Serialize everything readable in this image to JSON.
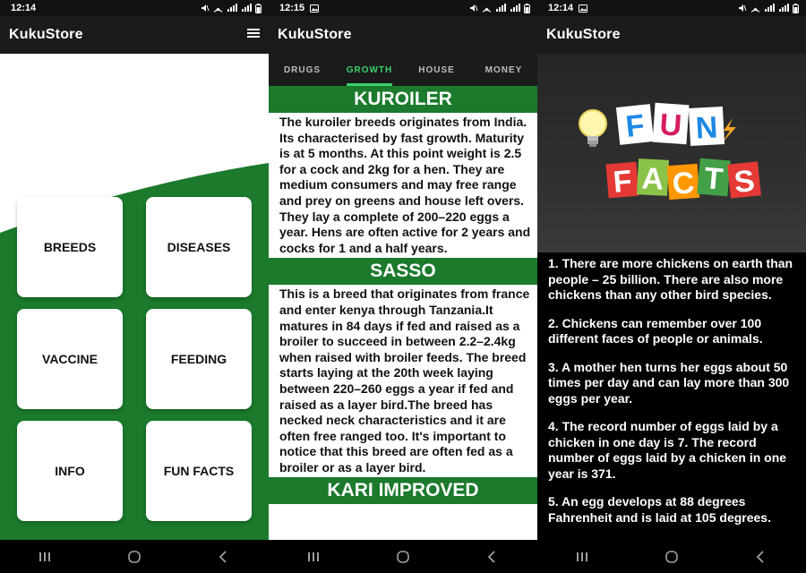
{
  "screens": [
    {
      "status_time": "12:14",
      "app_title": "KukuStore",
      "menu_icon": "hamburger-menu-icon",
      "tiles": [
        "BREEDS",
        "DISEASES",
        "VACCINE",
        "FEEDING",
        "INFO",
        "FUN FACTS"
      ],
      "colors": {
        "green": "#1b7a2c",
        "bar": "#1b1b1b"
      }
    },
    {
      "status_time": "12:15",
      "app_title": "KukuStore",
      "tabs": [
        "DRUGS",
        "GROWTH",
        "HOUSE",
        "MONEY"
      ],
      "active_tab": "GROWTH",
      "breeds": [
        {
          "title": "KUROILER",
          "text": "The kuroiler breeds originates from India. Its characterised by fast growth. Maturity is at 5 months. At this point weight is 2.5 for a cock and 2kg for a hen. They are medium consumers and may free range and prey on greens and house left overs. They lay a complete of 200–220 eggs a year. Hens are often active for 2 years and cocks for 1 and a half years."
        },
        {
          "title": "SASSO",
          "text": "This is a breed that originates from france and enter kenya through Tanzania.It matures in 84 days if fed and raised as a broiler to succeed in between 2.2–2.4kg when raised with broiler feeds. The breed starts laying at the 20th week laying between 220–260 eggs a year if fed and raised as a layer bird.The breed has necked neck characteristics and it are often free ranged too. It's important to notice that this breed are often fed as a broiler or as a layer bird."
        },
        {
          "title": "KARI IMPROVED",
          "text": ""
        }
      ],
      "colors": {
        "active_tab": "#3ad16a"
      }
    },
    {
      "status_time": "12:14",
      "app_title": "KukuStore",
      "banner_logo": {
        "line1": "FUN",
        "line2": "FACTS"
      },
      "facts": [
        "1. There are more chickens on earth than people – 25 billion. There are also more chickens than any other bird species.",
        "2. Chickens can remember over 100 different faces of people or animals.",
        "3. A mother hen turns her eggs about 50 times per day and can lay more than 300 eggs per year.",
        "4. The record number of eggs laid by a chicken in one day is 7. The record number of eggs laid by a chicken in one year is 371.",
        "5. An egg develops at 88 degrees Fahrenheit and is laid at 105 degrees."
      ]
    }
  ]
}
